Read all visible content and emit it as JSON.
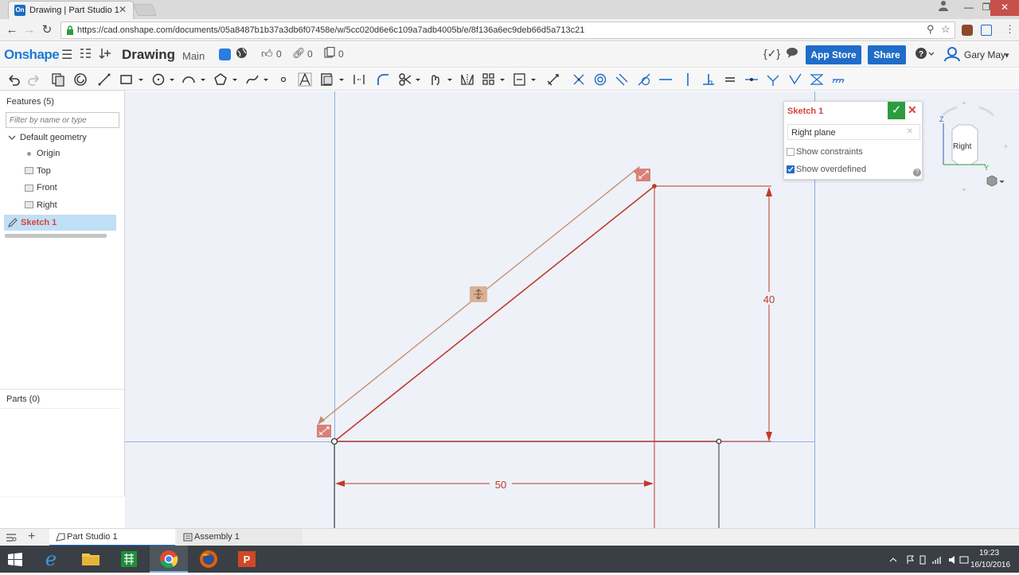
{
  "browser": {
    "tab_title": "Drawing | Part Studio 1",
    "favicon_text": "On",
    "url": "https://cad.onshape.com/documents/05a8487b1b37a3db6f07458e/w/5cc020d6e6c109a7adb4005b/e/8f136a6ec9deb66d5a713c21"
  },
  "header": {
    "logo": "Onshape",
    "document_name": "Drawing",
    "branch": "Main",
    "likes": "0",
    "links": "0",
    "versions": "0",
    "app_store_label": "App Store",
    "share_label": "Share",
    "user_name": "Gary May"
  },
  "feature_panel": {
    "title": "Features (5)",
    "filter_placeholder": "Filter by name or type",
    "default_geometry": "Default geometry",
    "items": [
      "Origin",
      "Top",
      "Front",
      "Right"
    ],
    "sketch": "Sketch 1",
    "parts_title": "Parts (0)"
  },
  "sketch_dialog": {
    "title": "Sketch 1",
    "plane": "Right plane",
    "show_constraints_label": "Show constraints",
    "show_constraints": false,
    "show_overdefined_label": "Show overdefined",
    "show_overdefined": true
  },
  "view_cube": {
    "face": "Right",
    "axis_z": "Z",
    "axis_y": "Y"
  },
  "sketch": {
    "dimension_horizontal": "50",
    "dimension_vertical": "40"
  },
  "tabs": {
    "part_studio": "Part Studio 1",
    "assembly": "Assembly 1"
  },
  "taskbar": {
    "time": "19:23",
    "date": "16/10/2016"
  },
  "colors": {
    "accent": "#1f6cc9",
    "sketch_red": "#c0392b",
    "overdefined": "#c48a6a",
    "canvas": "#eef1f8"
  }
}
